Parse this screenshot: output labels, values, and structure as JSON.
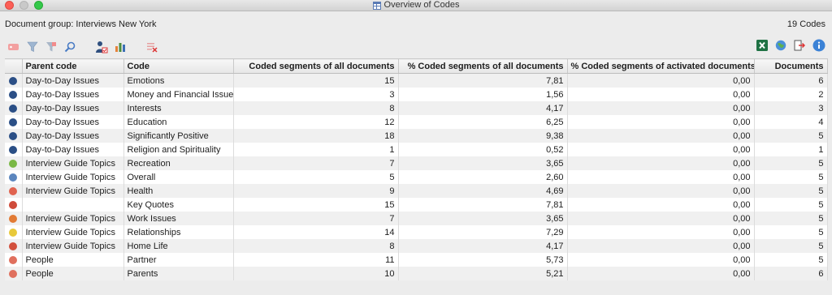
{
  "window": {
    "title": "Overview of Codes"
  },
  "info": {
    "document_group": "Document group: Interviews New York",
    "code_count": "19 Codes"
  },
  "toolbar": {
    "left_icons": [
      "tag-icon",
      "filter-icon",
      "filter-clear-icon",
      "search-icon",
      "user-activate-icon",
      "bar-chart-icon",
      "delete-list-icon"
    ],
    "right_icons": [
      "excel-export-icon",
      "web-export-icon",
      "export-icon",
      "info-icon"
    ]
  },
  "table": {
    "headers": [
      "",
      "Parent code",
      "Code",
      "Coded segments of all documents",
      "% Coded segments of all documents",
      "% Coded segments of activated documents",
      "Documents"
    ],
    "rows": [
      {
        "color": "#2b4f86",
        "parent": "Day-to-Day Issues",
        "code": "Emotions",
        "coded": "15",
        "pct_all": "7,81",
        "pct_act": "0,00",
        "docs": "6"
      },
      {
        "color": "#2b4f86",
        "parent": "Day-to-Day Issues",
        "code": "Money and Financial Issues",
        "coded": "3",
        "pct_all": "1,56",
        "pct_act": "0,00",
        "docs": "2"
      },
      {
        "color": "#2b4f86",
        "parent": "Day-to-Day Issues",
        "code": "Interests",
        "coded": "8",
        "pct_all": "4,17",
        "pct_act": "0,00",
        "docs": "3"
      },
      {
        "color": "#2b4f86",
        "parent": "Day-to-Day Issues",
        "code": "Education",
        "coded": "12",
        "pct_all": "6,25",
        "pct_act": "0,00",
        "docs": "4"
      },
      {
        "color": "#2b4f86",
        "parent": "Day-to-Day Issues",
        "code": "Significantly Positive",
        "coded": "18",
        "pct_all": "9,38",
        "pct_act": "0,00",
        "docs": "5"
      },
      {
        "color": "#2b4f86",
        "parent": "Day-to-Day Issues",
        "code": "Religion and Spirituality",
        "coded": "1",
        "pct_all": "0,52",
        "pct_act": "0,00",
        "docs": "1"
      },
      {
        "color": "#7ab846",
        "parent": "Interview Guide Topics",
        "code": "Recreation",
        "coded": "7",
        "pct_all": "3,65",
        "pct_act": "0,00",
        "docs": "5"
      },
      {
        "color": "#5b86be",
        "parent": "Interview Guide Topics",
        "code": "Overall",
        "coded": "5",
        "pct_all": "2,60",
        "pct_act": "0,00",
        "docs": "5"
      },
      {
        "color": "#e0634f",
        "parent": "Interview Guide Topics",
        "code": "Health",
        "coded": "9",
        "pct_all": "4,69",
        "pct_act": "0,00",
        "docs": "5"
      },
      {
        "color": "#cf4b3a",
        "parent": "",
        "code": "Key Quotes",
        "coded": "15",
        "pct_all": "7,81",
        "pct_act": "0,00",
        "docs": "5"
      },
      {
        "color": "#e27b35",
        "parent": "Interview Guide Topics",
        "code": "Work Issues",
        "coded": "7",
        "pct_all": "3,65",
        "pct_act": "0,00",
        "docs": "5"
      },
      {
        "color": "#e8c93a",
        "parent": "Interview Guide Topics",
        "code": "Relationships",
        "coded": "14",
        "pct_all": "7,29",
        "pct_act": "0,00",
        "docs": "5"
      },
      {
        "color": "#d2503d",
        "parent": "Interview Guide Topics",
        "code": "Home Life",
        "coded": "8",
        "pct_all": "4,17",
        "pct_act": "0,00",
        "docs": "5"
      },
      {
        "color": "#e0705e",
        "parent": "People",
        "code": "Partner",
        "coded": "11",
        "pct_all": "5,73",
        "pct_act": "0,00",
        "docs": "5"
      },
      {
        "color": "#e0705e",
        "parent": "People",
        "code": "Parents",
        "coded": "10",
        "pct_all": "5,21",
        "pct_act": "0,00",
        "docs": "6"
      }
    ]
  }
}
